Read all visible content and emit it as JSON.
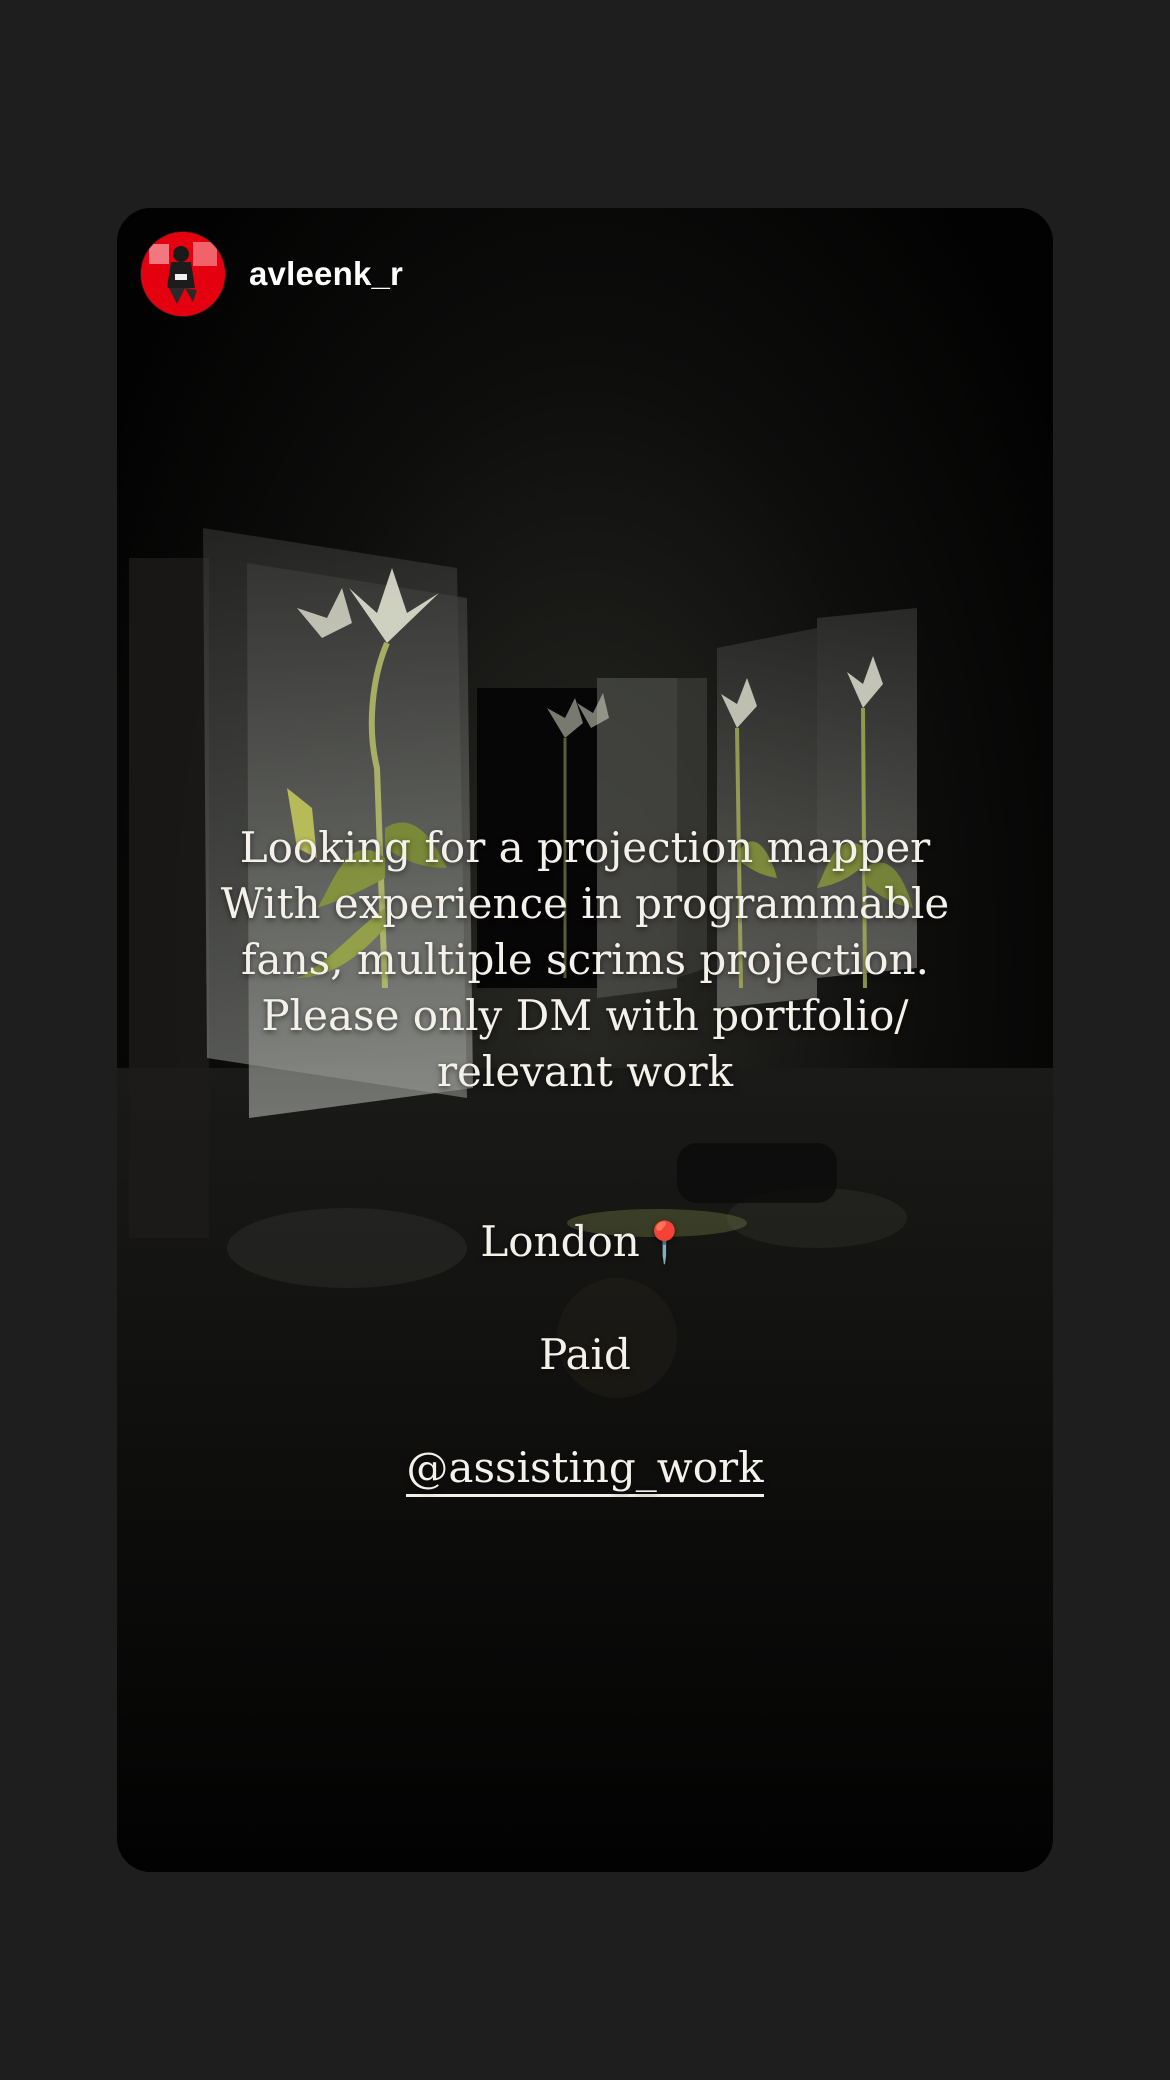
{
  "story": {
    "username": "avleenk_r",
    "avatar_icon": "profile-photo-icon",
    "caption_lines": [
      "Looking for a projection mapper",
      "With experience in programmable",
      "fans, multiple scrims projection.",
      "Please only DM with portfolio/",
      "relevant work"
    ],
    "location": "London",
    "location_icon": "pushpin-icon",
    "location_emoji": "📍",
    "paid": "Paid",
    "mention": "@assisting_work"
  },
  "colors": {
    "page_background": "#1e1e1e",
    "story_background": "#050505",
    "avatar_background": "#e5000f",
    "text": "#f4f1ea"
  }
}
